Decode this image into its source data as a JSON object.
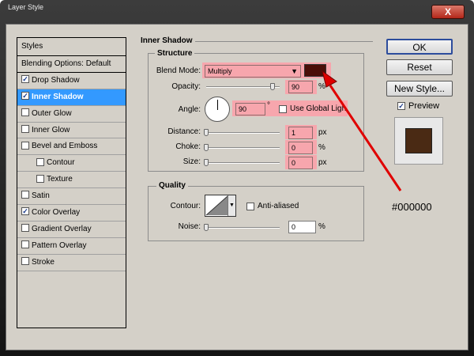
{
  "window": {
    "title": "Layer Style",
    "close_glyph": "X"
  },
  "styles_list": {
    "header": "Styles",
    "blending_options": "Blending Options: Default",
    "items": [
      {
        "label": "Drop Shadow",
        "checked": true
      },
      {
        "label": "Inner Shadow",
        "checked": true,
        "selected": true
      },
      {
        "label": "Outer Glow",
        "checked": false
      },
      {
        "label": "Inner Glow",
        "checked": false
      },
      {
        "label": "Bevel and Emboss",
        "checked": false
      },
      {
        "label": "Contour",
        "checked": false,
        "sub": true
      },
      {
        "label": "Texture",
        "checked": false,
        "sub": true
      },
      {
        "label": "Satin",
        "checked": false
      },
      {
        "label": "Color Overlay",
        "checked": true
      },
      {
        "label": "Gradient Overlay",
        "checked": false
      },
      {
        "label": "Pattern Overlay",
        "checked": false
      },
      {
        "label": "Stroke",
        "checked": false
      }
    ]
  },
  "inner_shadow": {
    "title": "Inner Shadow",
    "structure": {
      "title": "Structure",
      "blend_mode_label": "Blend Mode:",
      "blend_mode_value": "Multiply",
      "blend_color": "#4a0e08",
      "opacity_label": "Opacity:",
      "opacity_value": "90",
      "opacity_unit": "%",
      "opacity_level": 90,
      "angle_label": "Angle:",
      "angle_value": "90",
      "angle_unit": "°",
      "use_global_light_label": "Use Global Light",
      "use_global_light": false,
      "distance_label": "Distance:",
      "distance_value": "1",
      "distance_unit": "px",
      "distance_level": 1,
      "choke_label": "Choke:",
      "choke_value": "0",
      "choke_unit": "%",
      "choke_level": 0,
      "size_label": "Size:",
      "size_value": "0",
      "size_unit": "px",
      "size_level": 0
    },
    "quality": {
      "title": "Quality",
      "contour_label": "Contour:",
      "anti_aliased_label": "Anti-aliased",
      "anti_aliased": false,
      "noise_label": "Noise:",
      "noise_value": "0",
      "noise_unit": "%",
      "noise_level": 0
    }
  },
  "buttons": {
    "ok": "OK",
    "reset": "Reset",
    "new_style": "New Style...",
    "preview_label": "Preview",
    "preview_checked": true,
    "preview_swatch_color": "#4a2a14"
  },
  "annotation": {
    "text": "#000000",
    "color": "#e00000"
  }
}
